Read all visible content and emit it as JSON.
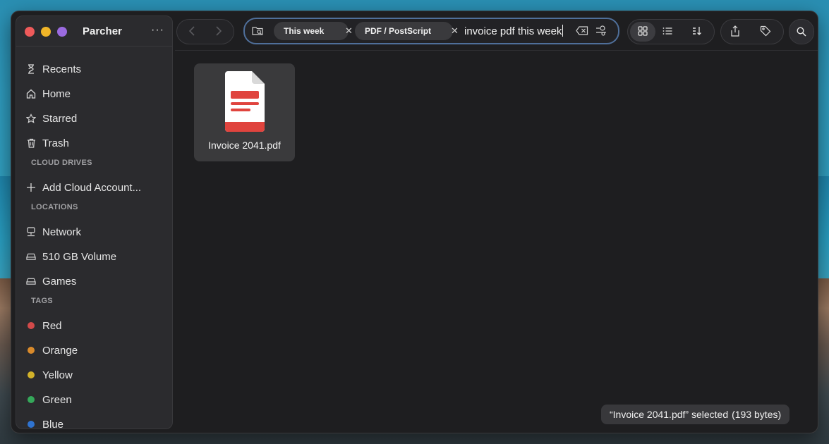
{
  "app": {
    "title": "Parcher",
    "more": "···"
  },
  "sidebar": {
    "items": [
      {
        "label": "Recents",
        "icon": "hourglass-icon"
      },
      {
        "label": "Home",
        "icon": "home-icon"
      },
      {
        "label": "Starred",
        "icon": "star-icon"
      },
      {
        "label": "Trash",
        "icon": "trash-icon"
      }
    ],
    "cloud": {
      "title": "CLOUD DRIVES",
      "add_label": "Add Cloud Account..."
    },
    "locations": {
      "title": "LOCATIONS",
      "items": [
        {
          "label": "Network",
          "icon": "network-icon"
        },
        {
          "label": "510 GB Volume",
          "icon": "drive-icon"
        },
        {
          "label": "Games",
          "icon": "drive-icon"
        }
      ]
    },
    "tags": {
      "title": "TAGS",
      "items": [
        {
          "label": "Red",
          "color": "#d24a4a"
        },
        {
          "label": "Orange",
          "color": "#d98a2b"
        },
        {
          "label": "Yellow",
          "color": "#d2b22a"
        },
        {
          "label": "Green",
          "color": "#35a85a"
        },
        {
          "label": "Blue",
          "color": "#2f73d0"
        }
      ]
    }
  },
  "search": {
    "chips": [
      {
        "label": "This week"
      },
      {
        "label": "PDF / PostScript"
      }
    ],
    "query": "invoice pdf this week"
  },
  "files": [
    {
      "name": "Invoice 2041.pdf",
      "icon": "pdf-file-icon"
    }
  ],
  "status": {
    "selected": "“Invoice 2041.pdf” selected",
    "size": "(193 bytes)"
  },
  "colors": {
    "accent": "#4f6f9a",
    "pdf_red": "#e0443e"
  }
}
